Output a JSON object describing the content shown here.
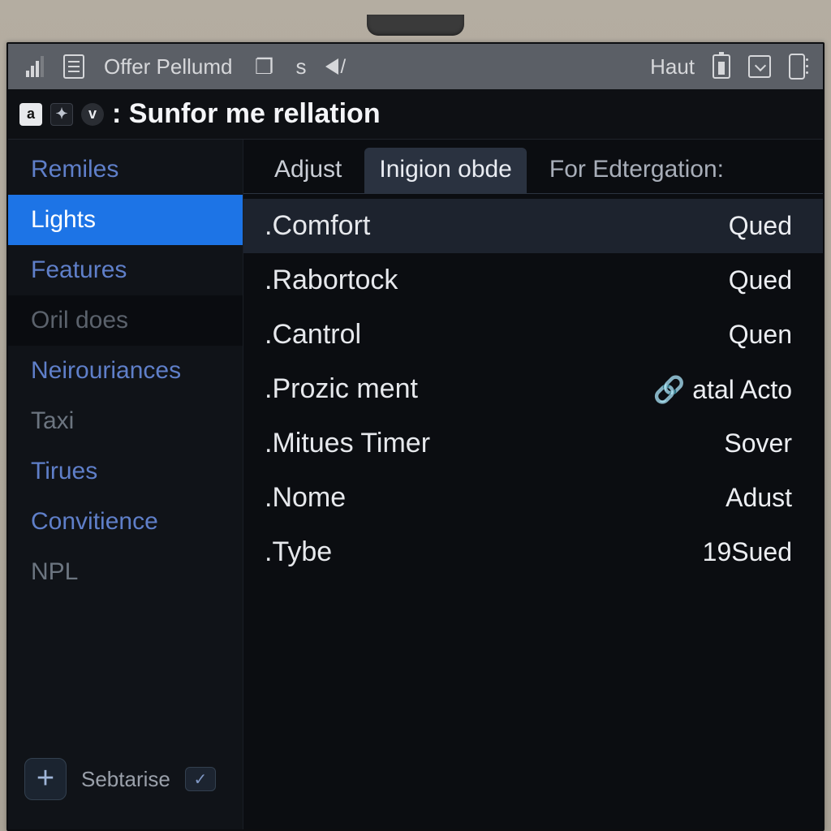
{
  "statusbar": {
    "left_label": "Offer Pellumd",
    "mid_label": "s",
    "right_label": "Haut"
  },
  "title": {
    "badge_a": "a",
    "badge_p": "✦",
    "badge_v": "v",
    "text": ": Sunfor me rellation"
  },
  "sidebar": {
    "items": [
      {
        "label": "Remiles",
        "key": "remiles"
      },
      {
        "label": "Lights",
        "key": "lights",
        "selected": true
      },
      {
        "label": "Features",
        "key": "features"
      },
      {
        "label": "Oril does",
        "key": "oril-does",
        "dim": true
      },
      {
        "label": "Neirouriances",
        "key": "neirouriances"
      },
      {
        "label": "Taxi",
        "key": "taxi",
        "muted": true
      },
      {
        "label": "Tirues",
        "key": "tirues"
      },
      {
        "label": "Convitience",
        "key": "convitience"
      },
      {
        "label": "NPL",
        "key": "npl",
        "muted": true
      }
    ],
    "footer_label": "Sebtarise"
  },
  "tabs": [
    {
      "label": "Adjust",
      "key": "adjust"
    },
    {
      "label": "Inigion obde",
      "key": "inigion",
      "active": true
    },
    {
      "label": "For Edtergation:",
      "key": "edtergation",
      "isLabel": true
    }
  ],
  "rows": [
    {
      "label": ".Comfort",
      "value": "Qued",
      "selected": true
    },
    {
      "label": ".Rabortock",
      "value": "Qued"
    },
    {
      "label": ".Cantrol",
      "value": "Quen"
    },
    {
      "label": ".Prozic ment",
      "value": "atal Acto",
      "prefixIcon": true
    },
    {
      "label": ".Mitues Timer",
      "value": "Sover"
    },
    {
      "label": ".Nome",
      "value": "Adust"
    },
    {
      "label": ".Tybe",
      "value": "19Sued"
    }
  ]
}
